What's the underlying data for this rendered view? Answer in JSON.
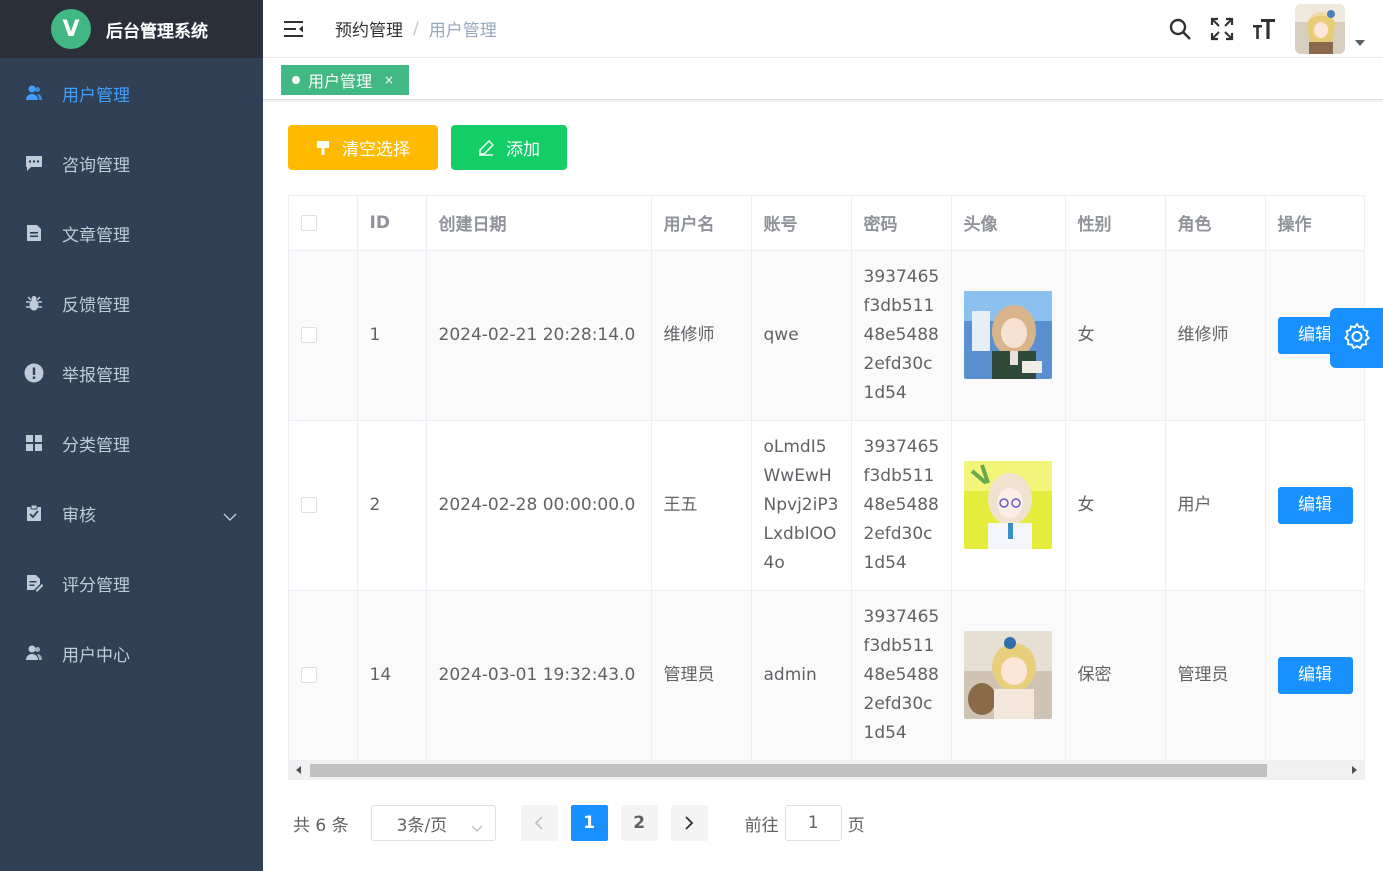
{
  "app": {
    "title": "后台管理系统",
    "logo_letter": "V"
  },
  "sidebar": {
    "items": [
      {
        "label": "用户管理",
        "icon": "user-icon",
        "active": true
      },
      {
        "label": "咨询管理",
        "icon": "chat-icon"
      },
      {
        "label": "文章管理",
        "icon": "document-icon"
      },
      {
        "label": "反馈管理",
        "icon": "bug-icon"
      },
      {
        "label": "举报管理",
        "icon": "warning-icon"
      },
      {
        "label": "分类管理",
        "icon": "grid-icon"
      },
      {
        "label": "审核",
        "icon": "clipboard-check-icon",
        "has_submenu": true
      },
      {
        "label": "评分管理",
        "icon": "edit-document-icon"
      },
      {
        "label": "用户中心",
        "icon": "user-icon"
      }
    ]
  },
  "header": {
    "breadcrumb": [
      "预约管理",
      "用户管理"
    ],
    "breadcrumb_separator": "/"
  },
  "tags": {
    "active": "用户管理",
    "close": "×"
  },
  "toolbar": {
    "clear_label": "清空选择",
    "add_label": "添加"
  },
  "table": {
    "columns": [
      "ID",
      "创建日期",
      "用户名",
      "账号",
      "密码",
      "头像",
      "性别",
      "角色",
      "操作"
    ],
    "rows": [
      {
        "id": "1",
        "created": "2024-02-21 20:28:14.0",
        "username": "维修师",
        "account": "qwe",
        "password": "3937465f3db51148e54882efd30c1d54",
        "gender": "女",
        "role": "维修师",
        "action": "编辑"
      },
      {
        "id": "2",
        "created": "2024-02-28 00:00:00.0",
        "username": "王五",
        "account": "oLmdI5WwEwHNpvj2iP3LxdbIOO4o",
        "password": "3937465f3db51148e54882efd30c1d54",
        "gender": "女",
        "role": "用户",
        "action": "编辑"
      },
      {
        "id": "14",
        "created": "2024-03-01 19:32:43.0",
        "username": "管理员",
        "account": "admin",
        "password": "3937465f3db51148e54882efd30c1d54",
        "gender": "保密",
        "role": "管理员",
        "action": "编辑"
      }
    ]
  },
  "pagination": {
    "total_text": "共 6 条",
    "page_size": "3条/页",
    "pages": [
      "1",
      "2"
    ],
    "current_page": "1",
    "goto_label": "前往",
    "goto_value": "1",
    "goto_suffix": "页"
  },
  "colors": {
    "sidebar_bg": "#304156",
    "accent": "#1890ff",
    "warning": "#ffba00",
    "success": "#13ce66",
    "tag": "#42b983"
  }
}
